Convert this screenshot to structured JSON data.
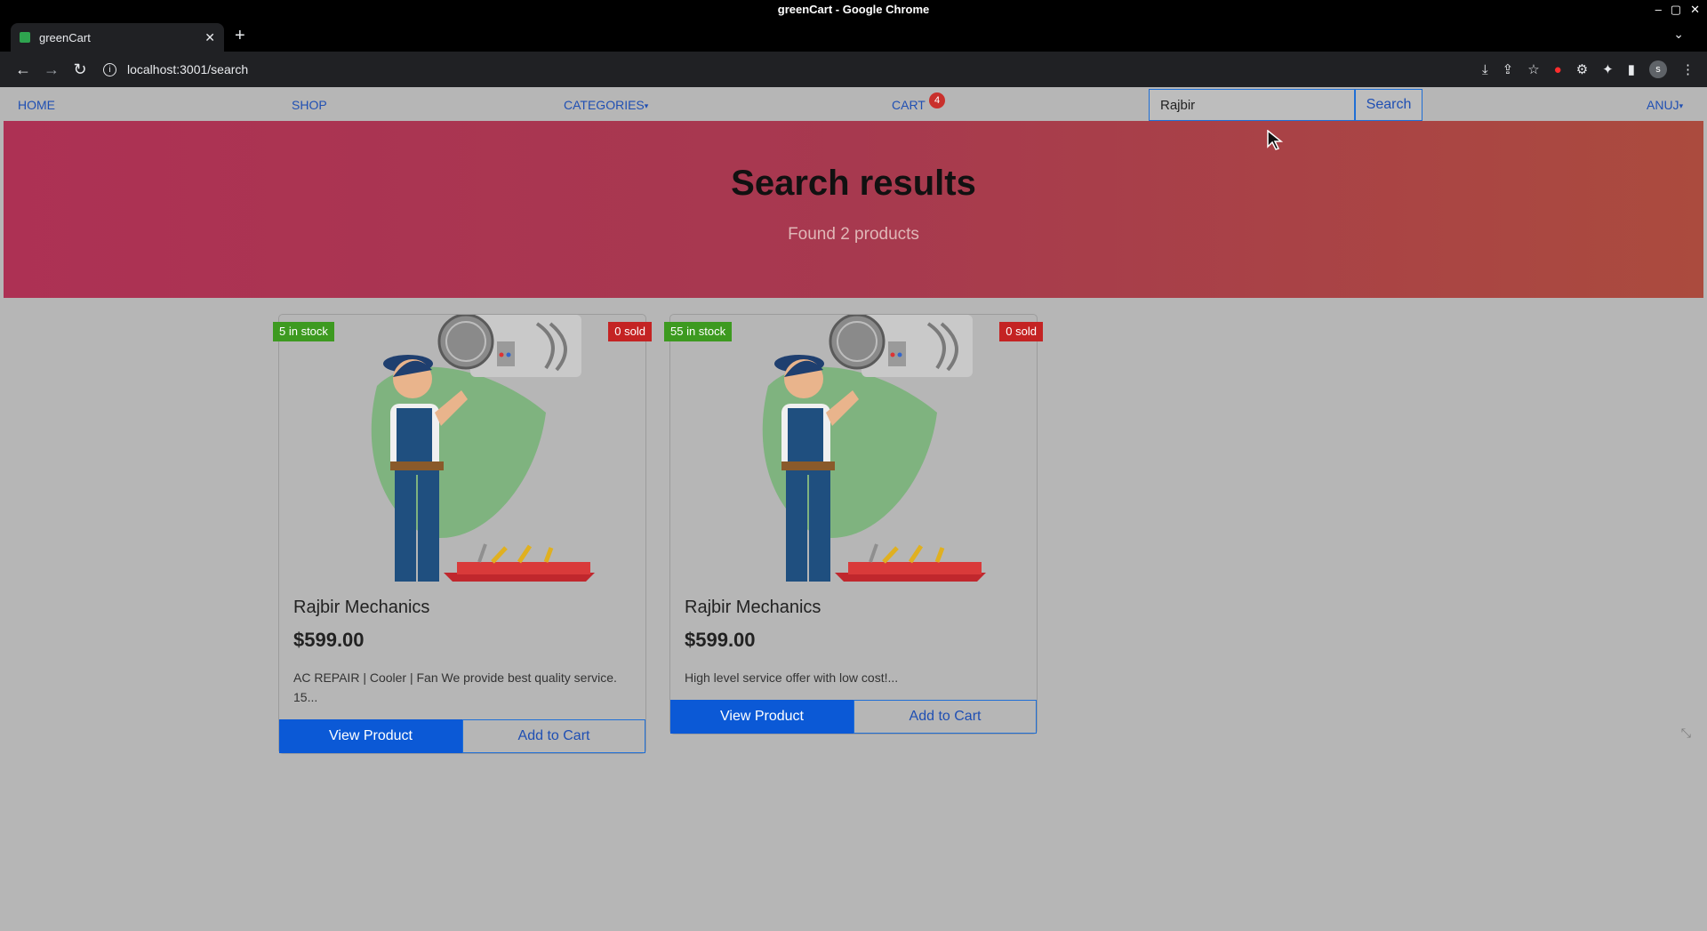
{
  "browser": {
    "window_title": "greenCart - Google Chrome",
    "tab_title": "greenCart",
    "url": "localhost:3001/search",
    "avatar_letter": "s"
  },
  "navbar": {
    "home": "HOME",
    "shop": "SHOP",
    "categories": "CATEGORIES",
    "cart": "CART",
    "cart_count": "4",
    "search_value": "Rajbir",
    "search_button": "Search",
    "user": "ANUJ"
  },
  "hero": {
    "title": "Search results",
    "subtitle": "Found 2 products"
  },
  "products": [
    {
      "stock": "5 in stock",
      "sold": "0 sold",
      "name": "Rajbir Mechanics",
      "price": "$599.00",
      "description": "AC REPAIR | Cooler | Fan We provide best quality service. 15...",
      "view_label": "View Product",
      "add_label": "Add to Cart"
    },
    {
      "stock": "55 in stock",
      "sold": "0 sold",
      "name": "Rajbir Mechanics",
      "price": "$599.00",
      "description": "High level service offer with low cost!...",
      "view_label": "View Product",
      "add_label": "Add to Cart"
    }
  ],
  "colors": {
    "primary": "#0b59d6",
    "stock_badge": "#3d9a20",
    "sold_badge": "#c42323"
  }
}
